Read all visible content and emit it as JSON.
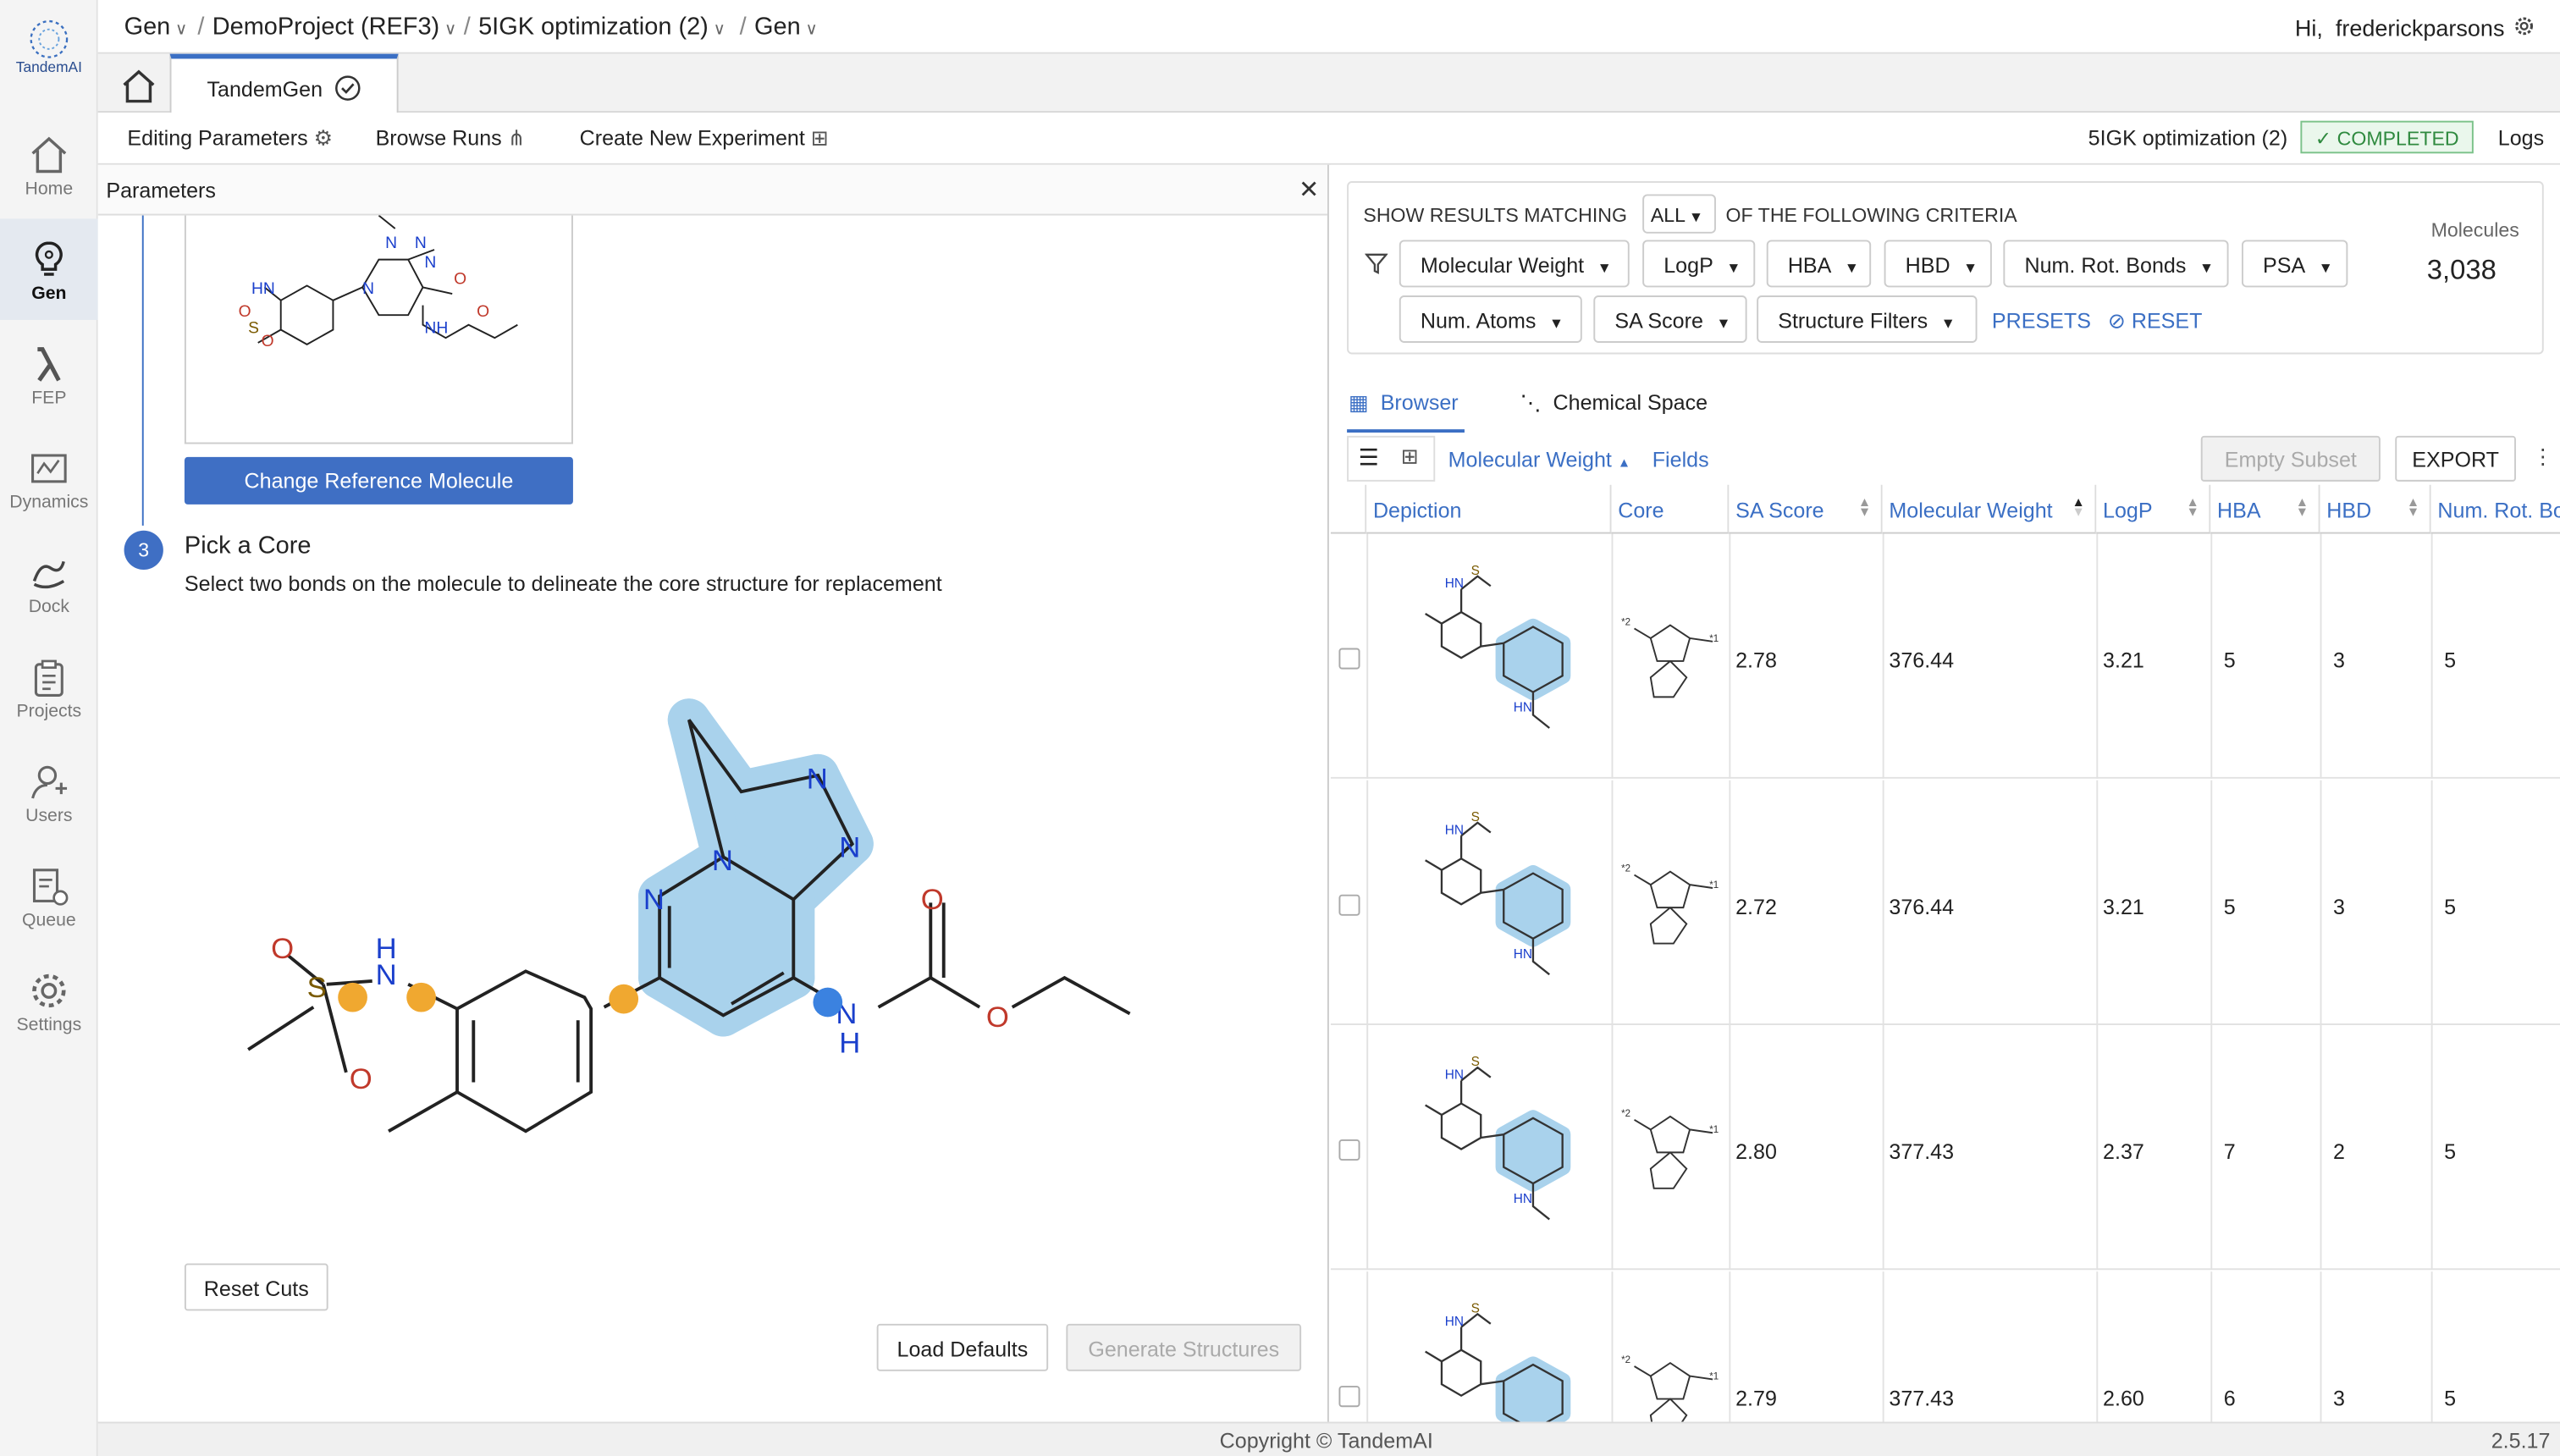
{
  "app": {
    "logo_text": "TandemAI",
    "version": "2.5.17",
    "copyright": "Copyright © TandemAI"
  },
  "sidebar": {
    "items": [
      {
        "label": "Home",
        "icon": "home-icon"
      },
      {
        "label": "Gen",
        "icon": "gen-icon",
        "active": true
      },
      {
        "label": "FEP",
        "icon": "lambda-icon"
      },
      {
        "label": "Dynamics",
        "icon": "dynamics-icon"
      },
      {
        "label": "Dock",
        "icon": "dock-icon"
      },
      {
        "label": "Projects",
        "icon": "clipboard-icon"
      },
      {
        "label": "Users",
        "icon": "users-icon"
      },
      {
        "label": "Queue",
        "icon": "queue-icon"
      },
      {
        "label": "Settings",
        "icon": "gear-icon"
      }
    ]
  },
  "breadcrumb": {
    "items": [
      "Gen",
      "DemoProject (REF3)",
      "5IGK optimization (2)",
      "Gen"
    ],
    "separator": "/"
  },
  "user": {
    "greeting": "Hi,",
    "name": "frederickparsons"
  },
  "tabs": {
    "active": "TandemGen"
  },
  "toolbar": {
    "editing": "Editing Parameters",
    "browse": "Browse Runs",
    "create": "Create New Experiment",
    "run_name": "5IGK optimization (2)",
    "status": "COMPLETED",
    "logs": "Logs"
  },
  "params": {
    "title": "Parameters",
    "change_ref": "Change Reference Molecule",
    "step_number": "3",
    "step_title": "Pick a Core",
    "step_desc": "Select two bonds on the molecule to delineate the core structure for replacement",
    "reset_cuts": "Reset Cuts",
    "load_defaults": "Load Defaults",
    "generate": "Generate Structures"
  },
  "filters": {
    "prefix": "SHOW RESULTS MATCHING",
    "match": "ALL",
    "suffix": "OF THE FOLLOWING CRITERIA",
    "criteria": [
      "Molecular Weight",
      "LogP",
      "HBA",
      "HBD",
      "Num. Rot. Bonds",
      "PSA",
      "Num. Atoms",
      "SA Score",
      "Structure Filters"
    ],
    "presets": "PRESETS",
    "reset": "RESET",
    "molecules_label": "Molecules",
    "molecules_count": "3,038"
  },
  "view_tabs": {
    "browser": "Browser",
    "chemical_space": "Chemical Space"
  },
  "subbar": {
    "sort_field": "Molecular Weight",
    "fields": "Fields",
    "empty_subset": "Empty Subset",
    "export": "EXPORT"
  },
  "table": {
    "columns": [
      "Depiction",
      "Core",
      "SA Score",
      "Molecular Weight",
      "LogP",
      "HBA",
      "HBD",
      "Num. Rot. Bo"
    ],
    "rows": [
      {
        "sa": "2.78",
        "mw": "376.44",
        "logp": "3.21",
        "hba": "5",
        "hbd": "3",
        "rot": "5"
      },
      {
        "sa": "2.72",
        "mw": "376.44",
        "logp": "3.21",
        "hba": "5",
        "hbd": "3",
        "rot": "5"
      },
      {
        "sa": "2.80",
        "mw": "377.43",
        "logp": "2.37",
        "hba": "7",
        "hbd": "2",
        "rot": "5"
      },
      {
        "sa": "2.79",
        "mw": "377.43",
        "logp": "2.60",
        "hba": "6",
        "hbd": "3",
        "rot": "5"
      }
    ]
  },
  "colors": {
    "accent": "#3f6fc4",
    "success": "#2f8a3f",
    "highlight": "#a9d2ec",
    "cut_orange": "#f0a830",
    "cut_blue": "#3b82e0"
  }
}
